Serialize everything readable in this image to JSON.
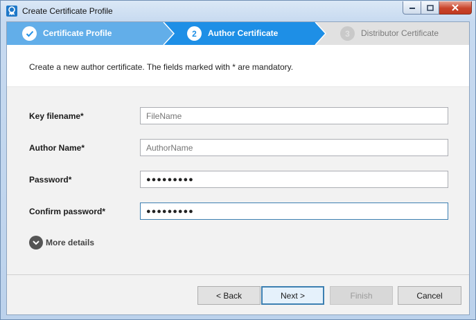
{
  "window": {
    "title": "Create Certificate Profile",
    "icon": "certificate-icon"
  },
  "steps": [
    {
      "number": "1",
      "label": "Certificate Profile",
      "state": "completed"
    },
    {
      "number": "2",
      "label": "Author Certificate",
      "state": "active"
    },
    {
      "number": "3",
      "label": "Distributor Certificate",
      "state": "pending"
    }
  ],
  "description": "Create a new author certificate. The fields marked with * are mandatory.",
  "form": {
    "key_filename": {
      "label": "Key filename*",
      "placeholder": "FileName",
      "value": ""
    },
    "author_name": {
      "label": "Author Name*",
      "placeholder": "AuthorName",
      "value": ""
    },
    "password": {
      "label": "Password*",
      "value": "●●●●●●●●●"
    },
    "confirm_password": {
      "label": "Confirm password*",
      "value": "●●●●●●●●●"
    }
  },
  "more_details": "More details",
  "buttons": {
    "back": "< Back",
    "next": "Next >",
    "finish": "Finish",
    "cancel": "Cancel"
  },
  "colors": {
    "step_active": "#1e8fe6",
    "step_completed": "#62aee9",
    "step_pending": "#e1e1e1"
  }
}
